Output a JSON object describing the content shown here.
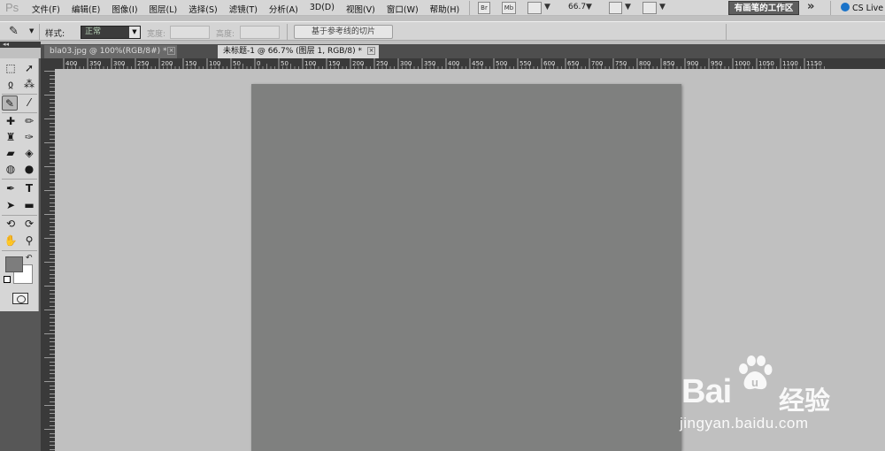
{
  "app": {
    "logo": "Ps"
  },
  "menubar": {
    "items": [
      "文件(F)",
      "编辑(E)",
      "图像(I)",
      "图层(L)",
      "选择(S)",
      "滤镜(T)",
      "分析(A)",
      "3D(D)",
      "视图(V)",
      "窗口(W)",
      "帮助(H)"
    ],
    "bridge_btn": "Br",
    "minibridge_btn": "Mb",
    "zoom": "66.7",
    "workspace_btn": "有画笔的工作区",
    "overflow": "»",
    "cs_live": "CS Live"
  },
  "options": {
    "style_label": "样式:",
    "style_value": "正常",
    "width_label": "宽度:",
    "height_label": "高度:",
    "slice_button": "基于参考线的切片"
  },
  "tabs": [
    {
      "label": "bla03.jpg @ 100%(RGB/8#) *",
      "active": false
    },
    {
      "label": "未标题-1 @ 66.7% (图层 1, RGB/8) *",
      "active": true
    }
  ],
  "ruler": {
    "h_labels": [
      "400",
      "350",
      "300",
      "250",
      "200",
      "150",
      "100",
      "50",
      "0",
      "50",
      "100",
      "150",
      "200",
      "250",
      "300",
      "350",
      "400",
      "450",
      "500",
      "550",
      "600",
      "650",
      "700",
      "750",
      "800",
      "850",
      "900",
      "950",
      "1000",
      "1050",
      "1100",
      "1150"
    ]
  },
  "toolbox": {
    "collapse": "◂◂",
    "tools": [
      "rect-marquee",
      "move",
      "lasso",
      "magic-wand",
      "slice",
      "eyedropper",
      "healing-brush",
      "brush",
      "clone-stamp",
      "history-brush",
      "eraser",
      "paint-bucket",
      "blur",
      "dodge",
      "pen",
      "type",
      "path-selection",
      "rectangle",
      "3d-rotate",
      "3d-orbit",
      "hand",
      "zoom"
    ]
  },
  "colors": {
    "foreground": "#7d7d7d",
    "background": "#ffffff",
    "document": "#7f807f",
    "canvas": "#c0c0c0"
  },
  "watermark": {
    "logo": "Bai",
    "logo_end": "u",
    "cn": "经验",
    "url": "jingyan.baidu.com"
  }
}
